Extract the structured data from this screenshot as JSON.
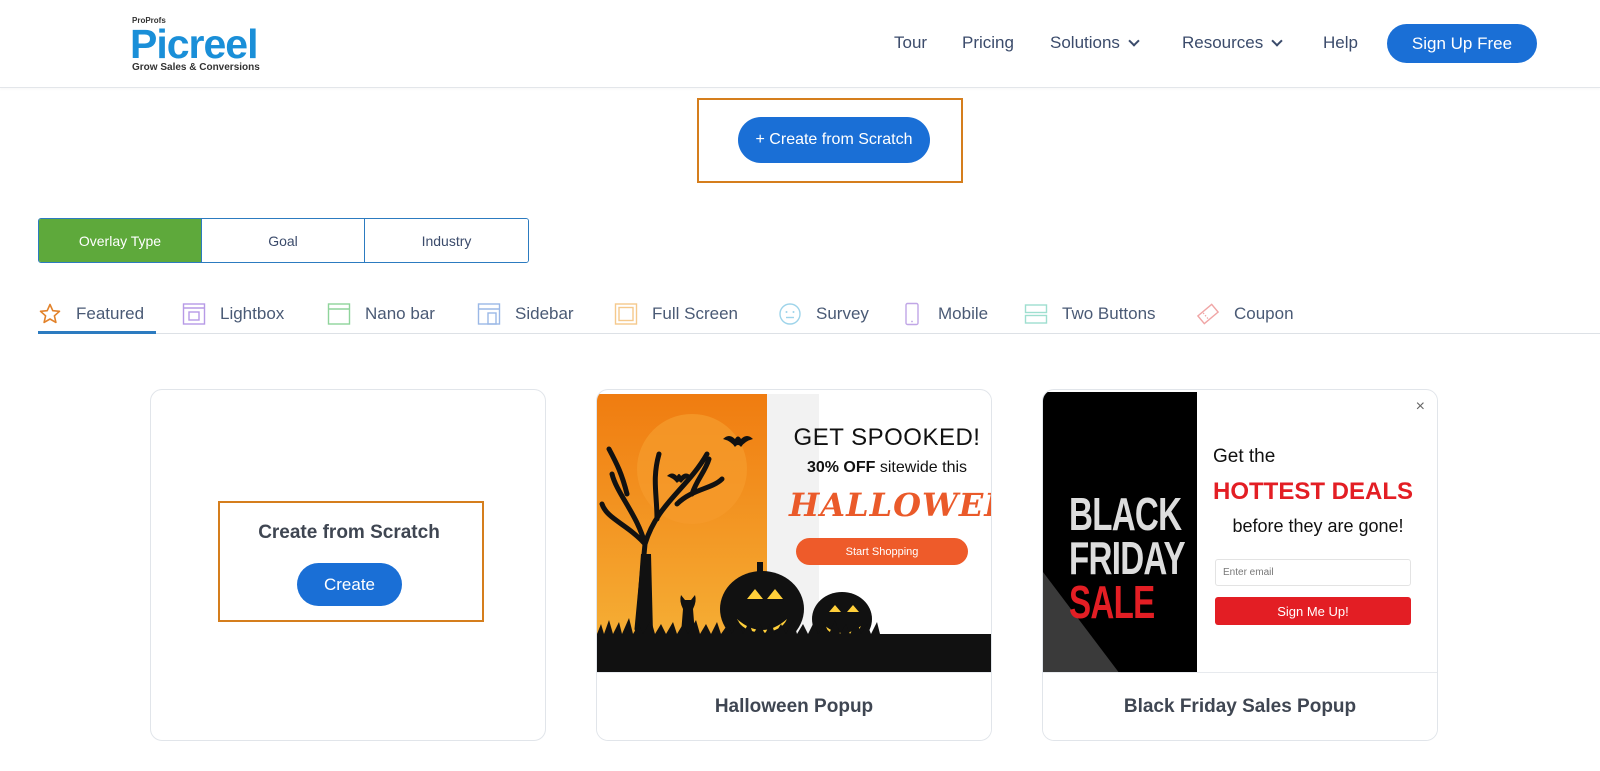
{
  "header": {
    "logo": {
      "brand_small": "ProProfs",
      "brand": "Picreel",
      "tagline": "Grow Sales & Conversions"
    },
    "nav": [
      {
        "label": "Tour",
        "has_dropdown": false
      },
      {
        "label": "Pricing",
        "has_dropdown": false
      },
      {
        "label": "Solutions",
        "has_dropdown": true
      },
      {
        "label": "Resources",
        "has_dropdown": true
      },
      {
        "label": "Help",
        "has_dropdown": false
      }
    ],
    "signup_label": "Sign Up Free"
  },
  "top_action": {
    "label": "+ Create from Scratch"
  },
  "filter_tabs": {
    "items": [
      "Overlay Type",
      "Goal",
      "Industry"
    ],
    "active": "Overlay Type"
  },
  "categories": {
    "items": [
      {
        "label": "Featured",
        "icon": "star-icon"
      },
      {
        "label": "Lightbox",
        "icon": "lightbox-icon"
      },
      {
        "label": "Nano bar",
        "icon": "nano-bar-icon"
      },
      {
        "label": "Sidebar",
        "icon": "sidebar-icon"
      },
      {
        "label": "Full Screen",
        "icon": "full-screen-icon"
      },
      {
        "label": "Survey",
        "icon": "survey-icon"
      },
      {
        "label": "Mobile",
        "icon": "mobile-icon"
      },
      {
        "label": "Two Buttons",
        "icon": "two-buttons-icon"
      },
      {
        "label": "Coupon",
        "icon": "coupon-icon"
      }
    ],
    "active": "Featured"
  },
  "cards": {
    "scratch": {
      "title": "Create from Scratch",
      "button": "Create"
    },
    "halloween": {
      "title": "Halloween Popup",
      "headline": "GET SPOOKED!",
      "offer_bold": "30% OFF",
      "offer_rest": "sitewide this",
      "word": "HALLOWEEN",
      "button": "Start Shopping"
    },
    "black_friday": {
      "title": "Black Friday Sales Popup",
      "side_line1": "BLACK",
      "side_line2": "FRIDAY",
      "side_line3": "SALE",
      "get_the": "Get the",
      "hottest": "HOTTEST DEALS",
      "before": "before they are gone!",
      "email_placeholder": "Enter email",
      "button": "Sign Me Up!",
      "close": "×"
    }
  },
  "colors": {
    "primary": "#1a6fd6",
    "active_tab": "#5ea93b",
    "highlight": "#d57e1d",
    "halloween_orange": "#f27a0c",
    "bf_red": "#e31e24"
  }
}
